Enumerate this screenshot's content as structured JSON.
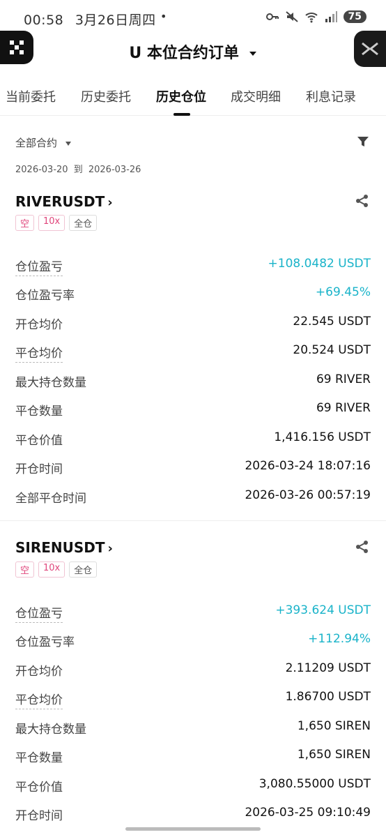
{
  "status_bar": {
    "time": "00:58",
    "date": "3月26日周四",
    "dot": "•",
    "battery": "75"
  },
  "header": {
    "title": "U 本位合约订单"
  },
  "tabs": [
    {
      "label": "当前委托"
    },
    {
      "label": "历史委托"
    },
    {
      "label": "历史仓位"
    },
    {
      "label": "成交明细"
    },
    {
      "label": "利息记录"
    }
  ],
  "filter": {
    "contract_select": "全部合约",
    "date_from": "2026-03-20",
    "date_sep": "到",
    "date_to": "2026-03-26"
  },
  "positions": [
    {
      "symbol": "RIVERUSDT",
      "tags": [
        "空",
        "10x",
        "全仓"
      ],
      "rows": [
        {
          "label": "仓位盈亏",
          "value": "+108.0482 USDT"
        },
        {
          "label": "仓位盈亏率",
          "value": "+69.45%"
        },
        {
          "label": "开仓均价",
          "value": "22.545 USDT"
        },
        {
          "label": "平仓均价",
          "value": "20.524 USDT"
        },
        {
          "label": "最大持仓数量",
          "value": "69 RIVER"
        },
        {
          "label": "平仓数量",
          "value": "69 RIVER"
        },
        {
          "label": "平仓价值",
          "value": "1,416.156 USDT"
        },
        {
          "label": "开仓时间",
          "value": "2026-03-24 18:07:16"
        },
        {
          "label": "全部平仓时间",
          "value": "2026-03-26 00:57:19"
        }
      ]
    },
    {
      "symbol": "SIRENUSDT",
      "tags": [
        "空",
        "10x",
        "全仓"
      ],
      "rows": [
        {
          "label": "仓位盈亏",
          "value": "+393.624 USDT"
        },
        {
          "label": "仓位盈亏率",
          "value": "+112.94%"
        },
        {
          "label": "开仓均价",
          "value": "2.11209 USDT"
        },
        {
          "label": "平仓均价",
          "value": "1.86700 USDT"
        },
        {
          "label": "最大持仓数量",
          "value": "1,650 SIREN"
        },
        {
          "label": "平仓数量",
          "value": "1,650 SIREN"
        },
        {
          "label": "平仓价值",
          "value": "3,080.55000 USDT"
        },
        {
          "label": "开仓时间",
          "value": "2026-03-25 09:10:49"
        }
      ]
    }
  ],
  "colors": {
    "positive": "#19b3c9",
    "tag_pink": "#e0457b",
    "text_primary": "#111111",
    "text_secondary": "#444444"
  }
}
